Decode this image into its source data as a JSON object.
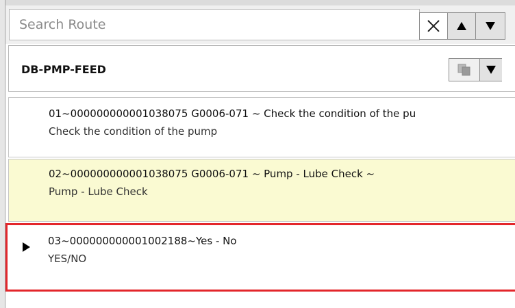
{
  "search": {
    "placeholder": "Search Route",
    "value": ""
  },
  "route": {
    "name": "DB-PMP-FEED"
  },
  "steps": [
    {
      "title": "01~000000000001038075 G0006-071 ~ Check the condition of the pu",
      "subtitle": "Check the condition of the pump"
    },
    {
      "title": "02~000000000001038075 G0006-071 ~ Pump - Lube Check ~",
      "subtitle": "Pump - Lube Check"
    },
    {
      "title": "03~000000000001002188~Yes - No",
      "subtitle": "YES/NO"
    }
  ],
  "colors": {
    "highlight_row": "#fafad2",
    "selection_border": "#e3262b"
  },
  "icons": {
    "clear": "close-icon",
    "up": "arrow-up-icon",
    "down": "arrow-down-icon",
    "copy": "copy-icon",
    "menu": "dropdown-arrow-icon",
    "marker": "current-step-marker-icon"
  }
}
